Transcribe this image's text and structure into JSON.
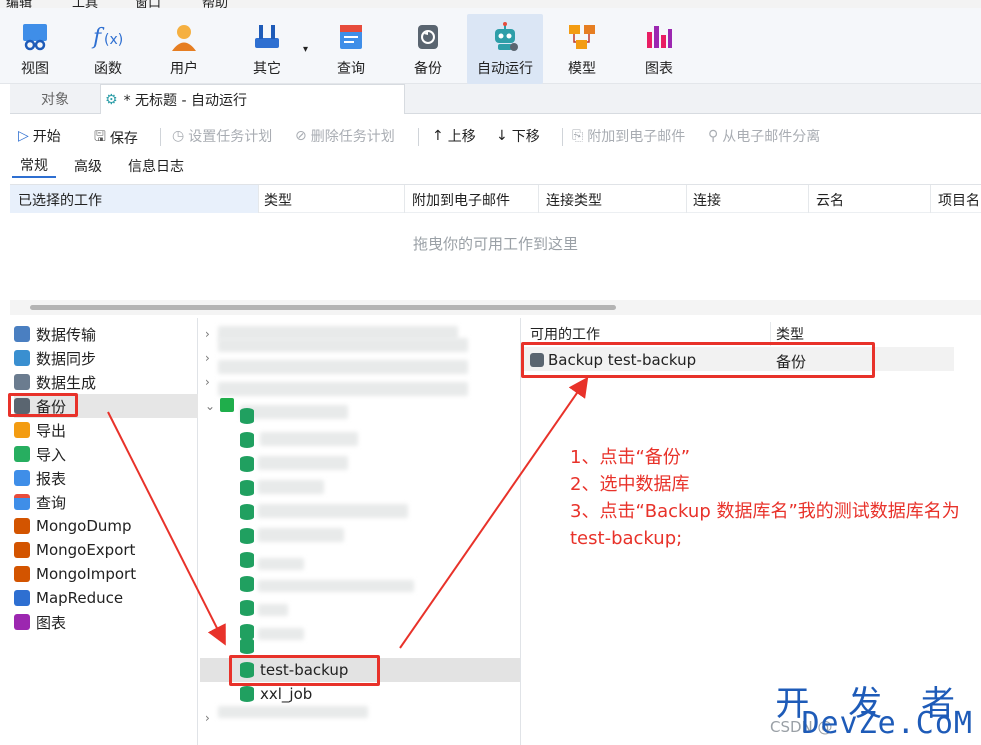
{
  "menu": {
    "items": [
      "编辑",
      "工具",
      "窗口",
      "帮助"
    ]
  },
  "toolbar": {
    "buttons": [
      {
        "label": "视图",
        "icon": "view-icon"
      },
      {
        "label": "函数",
        "icon": "function-icon"
      },
      {
        "label": "用户",
        "icon": "user-icon"
      },
      {
        "label": "其它",
        "icon": "tools-icon"
      },
      {
        "label": "查询",
        "icon": "query-icon"
      },
      {
        "label": "备份",
        "icon": "backup-icon"
      },
      {
        "label": "自动运行",
        "icon": "robot-icon"
      },
      {
        "label": "模型",
        "icon": "model-icon"
      },
      {
        "label": "图表",
        "icon": "chart-icon"
      }
    ],
    "active": "自动运行"
  },
  "tabs": {
    "objects": "对象",
    "current": "* 无标题 - 自动运行"
  },
  "actions": {
    "start": "开始",
    "save": "保存",
    "set_schedule": "设置任务计划",
    "delete_schedule": "删除任务计划",
    "move_up": "上移",
    "move_down": "下移",
    "attach_email": "附加到电子邮件",
    "detach_email": "从电子邮件分离"
  },
  "subtabs": [
    "常规",
    "高级",
    "信息日志"
  ],
  "job_table": {
    "columns": [
      "已选择的工作",
      "类型",
      "附加到电子邮件",
      "连接类型",
      "连接",
      "云名",
      "项目名"
    ],
    "drop_hint": "拖曳你的可用工作到这里"
  },
  "left_tree": [
    "数据传输",
    "数据同步",
    "数据生成",
    "备份",
    "导出",
    "导入",
    "报表",
    "查询",
    "MongoDump",
    "MongoExport",
    "MongoImport",
    "MapReduce",
    "图表"
  ],
  "left_selected": "备份",
  "mid_tree": {
    "selected": "test-backup",
    "next": "xxl_job"
  },
  "available": {
    "header_work": "可用的工作",
    "header_type": "类型",
    "row_name": "Backup test-backup",
    "row_type": "备份"
  },
  "annotations": {
    "line1": "1、点击“备份”",
    "line2": "2、选中数据库",
    "line3": "3、点击“Backup 数据库名”我的测试数据库名为 test-backup;"
  },
  "watermark": {
    "top": "开 发 者",
    "bottom": "DevZe.CoM",
    "csdn": "CSDN @"
  },
  "colors": {
    "annotation_red": "#e8322a",
    "accent_blue": "#2e6fd1",
    "db_green": "#20a060"
  }
}
